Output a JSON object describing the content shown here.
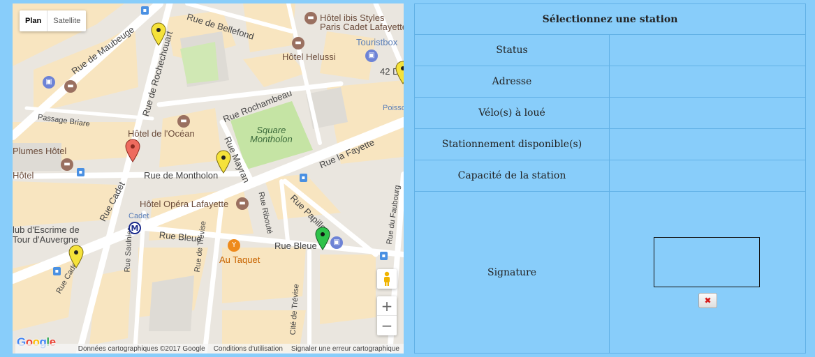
{
  "map": {
    "map_type_options": [
      "Plan",
      "Satellite"
    ],
    "map_type_selected": "Plan",
    "zoom_in": "+",
    "zoom_out": "−",
    "logo": "Google",
    "attribution": [
      "Données cartographiques ©2017 Google",
      "Conditions d'utilisation",
      "Signaler une erreur cartographique"
    ],
    "streets": [
      "Rue de Bellefond",
      "Rue de Maubeuge",
      "Rue de Rochechouart",
      "Rue Rochambeau",
      "Passage Briare",
      "Rue Mayran",
      "Rue la Fayette",
      "Rue de Montholon",
      "Rue Cadet",
      "Rue Ribouté",
      "Rue Papillon",
      "Rue Bleue",
      "Rue Bleue",
      "Rue de Trévise",
      "Rue Saulnier",
      "Cité de Trévise",
      "Rue Cadet",
      "Rue du Faubourg"
    ],
    "places": {
      "square": "Square\nMontholon",
      "hotel_ibis": "Hôtel ibis Styles\nParis Cadet Lafayette",
      "touristbox": "Touristbox",
      "hotel_helussi": "Hôtel Helussi",
      "hotel_ocean": "Hôtel de l'Océan",
      "plumes": "Plumes Hôtel",
      "hotel": "Hôtel",
      "hotel_opera": "Hôtel Opéra Lafayette",
      "cadet_metro": "Cadet",
      "club1": "lub d'Escrime de",
      "club2": "Tour d'Auvergne",
      "au_taquet": "Au Taquet",
      "num42": "42 D",
      "poisso": "Poisso"
    },
    "markers": [
      {
        "color": "#f5e23a",
        "label": "yellow-marker"
      },
      {
        "color": "#ee6b5e",
        "label": "red-marker"
      },
      {
        "color": "#f5e23a",
        "label": "yellow-marker"
      },
      {
        "color": "#2fc24a",
        "label": "green-marker"
      },
      {
        "color": "#f5e23a",
        "label": "yellow-marker"
      },
      {
        "color": "#f5e23a",
        "label": "yellow-marker"
      }
    ]
  },
  "station": {
    "header": "Sélectionnez une station",
    "rows": [
      {
        "label": "Status",
        "value": ""
      },
      {
        "label": "Adresse",
        "value": ""
      },
      {
        "label": "Vélo(s) à loué",
        "value": ""
      },
      {
        "label": "Stationnement disponible(s)",
        "value": ""
      },
      {
        "label": "Capacité de la station",
        "value": ""
      }
    ],
    "signature_label": "Signature",
    "clear_icon": "✖"
  },
  "colors": {
    "page_bg": "#88cdfa",
    "table_border": "#62b1e6",
    "park": "#c5e4a4",
    "block": "#f8e5c0",
    "road": "#ffffff"
  }
}
